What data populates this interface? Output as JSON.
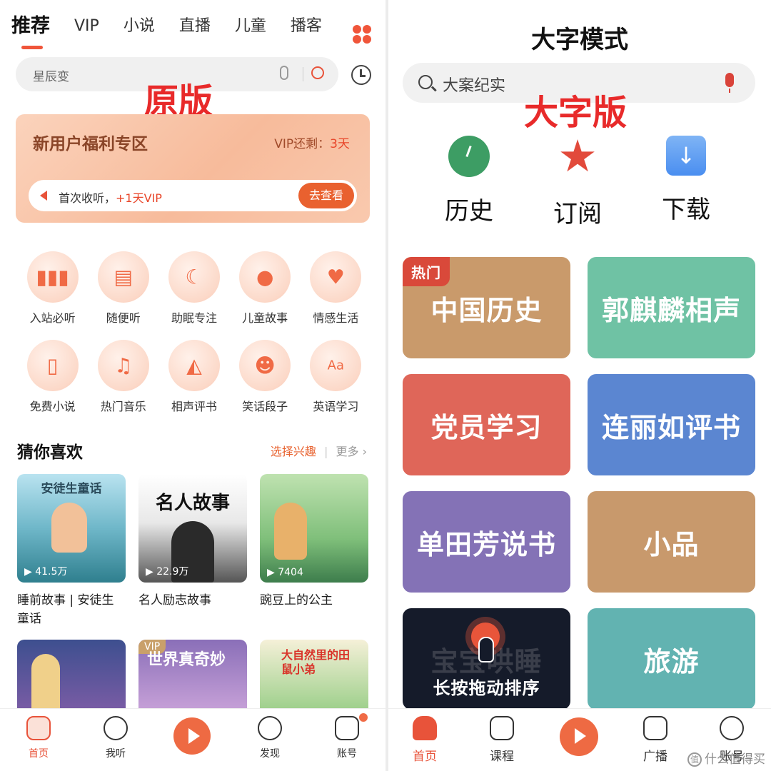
{
  "left": {
    "tabs": [
      "推荐",
      "VIP",
      "小说",
      "直播",
      "儿童",
      "播客"
    ],
    "search_placeholder": "星辰变",
    "label": "原版",
    "promo": {
      "title": "新用户福利专区",
      "vip_prefix": "VIP还剩：",
      "vip_days": "3天",
      "bar_text": "首次收听，",
      "bar_highlight": "+1天VIP",
      "button": "去查看"
    },
    "categories": [
      {
        "label": "入站必听",
        "icon": "bar-chart-icon"
      },
      {
        "label": "随便听",
        "icon": "radio-icon"
      },
      {
        "label": "助眠专注",
        "icon": "moon-icon"
      },
      {
        "label": "儿童故事",
        "icon": "duck-icon"
      },
      {
        "label": "情感生活",
        "icon": "heart-icon"
      },
      {
        "label": "免费小说",
        "icon": "book-icon"
      },
      {
        "label": "热门音乐",
        "icon": "music-note-icon"
      },
      {
        "label": "相声评书",
        "icon": "fan-icon"
      },
      {
        "label": "笑话段子",
        "icon": "laugh-face-icon"
      },
      {
        "label": "英语学习",
        "icon": "aa-chat-icon"
      }
    ],
    "guess": {
      "title": "猜你喜欢",
      "pick": "选择兴趣",
      "sep": "|",
      "more": "更多 ›"
    },
    "cards": [
      {
        "cover_text": "安徒生童话",
        "plays": "▶ 41.5万",
        "title": "睡前故事 | 安徒生童话"
      },
      {
        "cover_text": "名人故事",
        "plays": "▶ 22.9万",
        "title": "名人励志故事"
      },
      {
        "cover_text": "",
        "plays": "▶ 7404",
        "title": "豌豆上的公主"
      }
    ],
    "cards2": [
      {
        "cover_text": ""
      },
      {
        "cover_text": "世界真奇妙",
        "badge": "VIP"
      },
      {
        "cover_text": "大自然里的田鼠小弟"
      }
    ],
    "nav": [
      {
        "label": "首页",
        "active": true
      },
      {
        "label": "我听",
        "active": false
      },
      {
        "label": "发现",
        "active": false
      },
      {
        "label": "账号",
        "active": false
      }
    ]
  },
  "right": {
    "title": "大字模式",
    "search_placeholder": "大案纪实",
    "label": "大字版",
    "quick": [
      {
        "label": "历史",
        "icon": "clock-icon",
        "color": "#3d9d64"
      },
      {
        "label": "订阅",
        "icon": "star-check-icon",
        "color": "#e24a3b"
      },
      {
        "label": "下载",
        "icon": "download-icon",
        "color": "#4a8ef0"
      }
    ],
    "tiles": [
      {
        "label": "中国历史",
        "color": "#c99a6b",
        "badge": "热门"
      },
      {
        "label": "郭麒麟相声",
        "color": "#6fc2a4"
      },
      {
        "label": "党员学习",
        "color": "#df6659"
      },
      {
        "label": "连丽如评书",
        "color": "#5b86d1"
      },
      {
        "label": "单田芳说书",
        "color": "#8472b6"
      },
      {
        "label": "小品",
        "color": "#c8996c"
      },
      {
        "label": "宝宝哄睡",
        "color": "#151b2a",
        "overlay": "长按拖动排序"
      },
      {
        "label": "旅游",
        "color": "#62b3b1"
      }
    ],
    "nav": [
      {
        "label": "首页",
        "active": true
      },
      {
        "label": "课程",
        "active": false
      },
      {
        "label": "广播",
        "active": false
      },
      {
        "label": "账号",
        "active": false
      }
    ],
    "watermark": "什么值得买"
  }
}
